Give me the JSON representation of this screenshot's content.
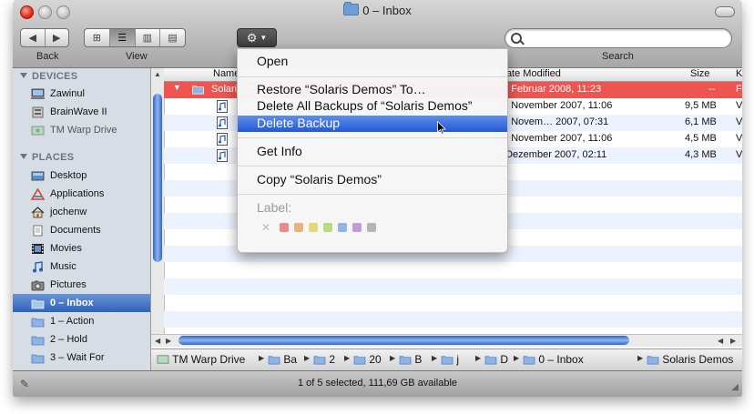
{
  "window": {
    "title": "0 – Inbox"
  },
  "toolbar": {
    "back_label": "Back",
    "view_label": "View",
    "search_label": "Search",
    "search_value": ""
  },
  "sidebar": {
    "devices_header": "DEVICES",
    "devices": [
      {
        "label": "Zawinul",
        "icon": "computer-icon"
      },
      {
        "label": "BrainWave II",
        "icon": "hard-drive-icon"
      },
      {
        "label": "TM Warp Drive",
        "icon": "external-drive-icon"
      }
    ],
    "places_header": "PLACES",
    "places": [
      {
        "label": "Desktop",
        "icon": "desktop-icon"
      },
      {
        "label": "Applications",
        "icon": "applications-icon"
      },
      {
        "label": "jochenw",
        "icon": "home-icon"
      },
      {
        "label": "Documents",
        "icon": "documents-icon"
      },
      {
        "label": "Movies",
        "icon": "movies-icon"
      },
      {
        "label": "Music",
        "icon": "music-icon"
      },
      {
        "label": "Pictures",
        "icon": "pictures-icon"
      },
      {
        "label": "0 – Inbox",
        "icon": "folder-icon",
        "selected": true
      },
      {
        "label": "1 – Action",
        "icon": "folder-icon"
      },
      {
        "label": "2 – Hold",
        "icon": "folder-icon"
      },
      {
        "label": "3 – Wait For",
        "icon": "folder-icon"
      }
    ]
  },
  "columns": {
    "name": "Name",
    "date": "Date Modified",
    "size": "Size",
    "kind": "K"
  },
  "files": [
    {
      "name": "Solaris Demos",
      "date": "7. Februar 2008, 11:23",
      "size": "--",
      "kind": "F",
      "highlight": true
    },
    {
      "name": "",
      "date": "0. November 2007, 11:06",
      "size": "9,5 MB",
      "kind": "V"
    },
    {
      "name": "",
      "date": "0. Novem… 2007, 07:31",
      "size": "6,1 MB",
      "kind": "V"
    },
    {
      "name": "",
      "date": "0. November 2007, 11:06",
      "size": "4,5 MB",
      "kind": "V"
    },
    {
      "name": "",
      "date": ". Dezember 2007, 02:11",
      "size": "4,3 MB",
      "kind": "V"
    }
  ],
  "menu": {
    "open": "Open",
    "restore": "Restore “Solaris Demos” To…",
    "delete_all": "Delete All Backups of “Solaris Demos”",
    "delete_backup": "Delete Backup",
    "get_info": "Get Info",
    "copy": "Copy “Solaris Demos”",
    "label": "Label:"
  },
  "label_colors": [
    "#e88a8a",
    "#e8b47a",
    "#e8d87a",
    "#b8dc7c",
    "#8fb4e8",
    "#c39ae0",
    "#b4b4b4"
  ],
  "pathbar": {
    "segments": [
      "TM Warp Drive",
      "Ba",
      "2",
      "20",
      "B",
      "j",
      "D",
      "0 – Inbox",
      "Solaris Demos"
    ]
  },
  "status": {
    "text": "1 of 5 selected, 111,69 GB available"
  }
}
